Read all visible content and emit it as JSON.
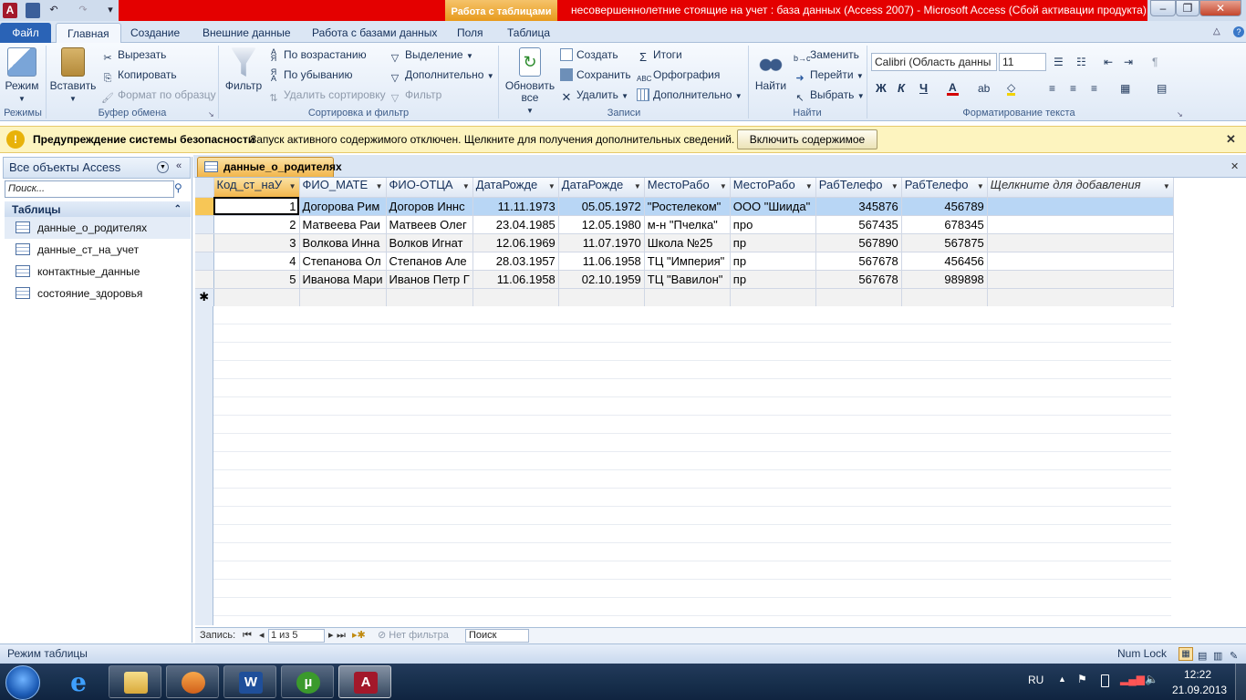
{
  "window": {
    "context_tab": "Работа с таблицами",
    "title": "несовершеннолетние стоящие на учет : база данных (Access 2007)  -  Microsoft Access (Сбой активации продукта)"
  },
  "ribbon_tabs": [
    "Файл",
    "Главная",
    "Создание",
    "Внешние данные",
    "Работа с базами данных",
    "Поля",
    "Таблица"
  ],
  "ribbon": {
    "views": {
      "label": "Режимы",
      "mode": "Режим"
    },
    "clipboard": {
      "label": "Буфер обмена",
      "paste": "Вставить",
      "cut": "Вырезать",
      "copy": "Копировать",
      "format": "Формат по образцу"
    },
    "sort": {
      "label": "Сортировка и фильтр",
      "filter": "Фильтр",
      "asc": "По возрастанию",
      "desc": "По убыванию",
      "remove": "Удалить сортировку",
      "selection": "Выделение",
      "advanced": "Дополнительно",
      "toggle": "Фильтр"
    },
    "records": {
      "label": "Записи",
      "refresh": "Обновить все",
      "new": "Создать",
      "save": "Сохранить",
      "delete": "Удалить",
      "totals": "Итоги",
      "spelling": "Орфография",
      "more": "Дополнительно"
    },
    "find": {
      "label": "Найти",
      "find": "Найти",
      "replace": "Заменить",
      "goto": "Перейти",
      "select": "Выбрать"
    },
    "text": {
      "label": "Форматирование текста",
      "font": "Calibri (Область данны",
      "size": "11",
      "bold": "Ж",
      "italic": "К",
      "underline": "Ч"
    }
  },
  "security": {
    "title": "Предупреждение системы безопасности",
    "message": "Запуск активного содержимого отключен. Щелкните для получения дополнительных сведений.",
    "button": "Включить содержимое"
  },
  "nav": {
    "header": "Все объекты Access",
    "search": "Поиск...",
    "category": "Таблицы",
    "items": [
      "данные_о_родителях",
      "данные_ст_на_учет",
      "контактные_данные",
      "состояние_здоровья"
    ]
  },
  "document_tab": "данные_о_родителях",
  "table": {
    "columns": [
      "Код_ст_наУ",
      "ФИО_МАТЕ",
      "ФИО-ОТЦА",
      "ДатаРожде",
      "ДатаРожде",
      "МестоРабо",
      "МестоРабо",
      "РабТелефо",
      "РабТелефо",
      "Щелкните для добавления"
    ],
    "rows": [
      [
        "1",
        "Догорова Рим",
        "Догоров Иннс",
        "11.11.1973",
        "05.05.1972",
        "\"Ростелеком\"",
        "ООО \"Шиида\"",
        "345876",
        "456789"
      ],
      [
        "2",
        "Матвеева Раи",
        "Матвеев Олег",
        "23.04.1985",
        "12.05.1980",
        "м-н \"Пчелка\"",
        "про",
        "567435",
        "678345"
      ],
      [
        "3",
        "Волкова Инна",
        "Волков Игнат",
        "12.06.1969",
        "11.07.1970",
        "Школа №25",
        "пр",
        "567890",
        "567875"
      ],
      [
        "4",
        "Степанова Ол",
        "Степанов Але",
        "28.03.1957",
        "11.06.1958",
        "ТЦ \"Империя\"",
        "пр",
        "567678",
        "456456"
      ],
      [
        "5",
        "Иванова Мари",
        "Иванов Петр Г",
        "11.06.1958",
        "02.10.1959",
        "ТЦ \"Вавилон\"",
        "пр",
        "567678",
        "989898"
      ]
    ]
  },
  "record_bar": {
    "label": "Запись:",
    "position": "1 из 5",
    "filter": "Нет фильтра",
    "search": "Поиск"
  },
  "status": {
    "mode": "Режим таблицы",
    "numlock": "Num Lock"
  },
  "tray": {
    "lang": "RU",
    "time": "12:22",
    "date": "21.09.2013"
  },
  "colors": {
    "title_red": "#e40000",
    "context_orange": "#e79a1c",
    "file_tab": "#2a63b6"
  }
}
